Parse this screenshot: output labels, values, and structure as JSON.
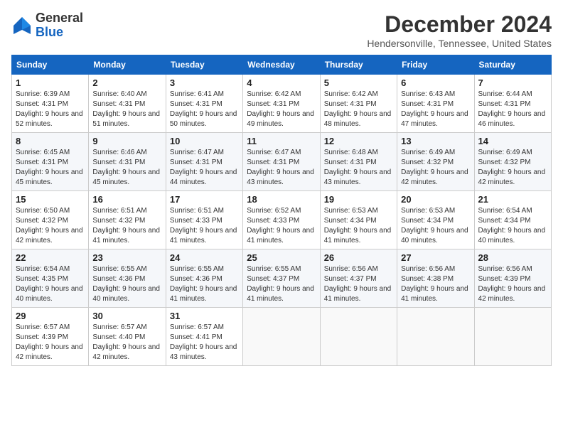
{
  "logo": {
    "line1": "General",
    "line2": "Blue"
  },
  "title": "December 2024",
  "location": "Hendersonville, Tennessee, United States",
  "days_of_week": [
    "Sunday",
    "Monday",
    "Tuesday",
    "Wednesday",
    "Thursday",
    "Friday",
    "Saturday"
  ],
  "weeks": [
    [
      {
        "day": "1",
        "sunrise": "6:39 AM",
        "sunset": "4:31 PM",
        "daylight": "9 hours and 52 minutes."
      },
      {
        "day": "2",
        "sunrise": "6:40 AM",
        "sunset": "4:31 PM",
        "daylight": "9 hours and 51 minutes."
      },
      {
        "day": "3",
        "sunrise": "6:41 AM",
        "sunset": "4:31 PM",
        "daylight": "9 hours and 50 minutes."
      },
      {
        "day": "4",
        "sunrise": "6:42 AM",
        "sunset": "4:31 PM",
        "daylight": "9 hours and 49 minutes."
      },
      {
        "day": "5",
        "sunrise": "6:42 AM",
        "sunset": "4:31 PM",
        "daylight": "9 hours and 48 minutes."
      },
      {
        "day": "6",
        "sunrise": "6:43 AM",
        "sunset": "4:31 PM",
        "daylight": "9 hours and 47 minutes."
      },
      {
        "day": "7",
        "sunrise": "6:44 AM",
        "sunset": "4:31 PM",
        "daylight": "9 hours and 46 minutes."
      }
    ],
    [
      {
        "day": "8",
        "sunrise": "6:45 AM",
        "sunset": "4:31 PM",
        "daylight": "9 hours and 45 minutes."
      },
      {
        "day": "9",
        "sunrise": "6:46 AM",
        "sunset": "4:31 PM",
        "daylight": "9 hours and 45 minutes."
      },
      {
        "day": "10",
        "sunrise": "6:47 AM",
        "sunset": "4:31 PM",
        "daylight": "9 hours and 44 minutes."
      },
      {
        "day": "11",
        "sunrise": "6:47 AM",
        "sunset": "4:31 PM",
        "daylight": "9 hours and 43 minutes."
      },
      {
        "day": "12",
        "sunrise": "6:48 AM",
        "sunset": "4:31 PM",
        "daylight": "9 hours and 43 minutes."
      },
      {
        "day": "13",
        "sunrise": "6:49 AM",
        "sunset": "4:32 PM",
        "daylight": "9 hours and 42 minutes."
      },
      {
        "day": "14",
        "sunrise": "6:49 AM",
        "sunset": "4:32 PM",
        "daylight": "9 hours and 42 minutes."
      }
    ],
    [
      {
        "day": "15",
        "sunrise": "6:50 AM",
        "sunset": "4:32 PM",
        "daylight": "9 hours and 42 minutes."
      },
      {
        "day": "16",
        "sunrise": "6:51 AM",
        "sunset": "4:32 PM",
        "daylight": "9 hours and 41 minutes."
      },
      {
        "day": "17",
        "sunrise": "6:51 AM",
        "sunset": "4:33 PM",
        "daylight": "9 hours and 41 minutes."
      },
      {
        "day": "18",
        "sunrise": "6:52 AM",
        "sunset": "4:33 PM",
        "daylight": "9 hours and 41 minutes."
      },
      {
        "day": "19",
        "sunrise": "6:53 AM",
        "sunset": "4:34 PM",
        "daylight": "9 hours and 41 minutes."
      },
      {
        "day": "20",
        "sunrise": "6:53 AM",
        "sunset": "4:34 PM",
        "daylight": "9 hours and 40 minutes."
      },
      {
        "day": "21",
        "sunrise": "6:54 AM",
        "sunset": "4:34 PM",
        "daylight": "9 hours and 40 minutes."
      }
    ],
    [
      {
        "day": "22",
        "sunrise": "6:54 AM",
        "sunset": "4:35 PM",
        "daylight": "9 hours and 40 minutes."
      },
      {
        "day": "23",
        "sunrise": "6:55 AM",
        "sunset": "4:36 PM",
        "daylight": "9 hours and 40 minutes."
      },
      {
        "day": "24",
        "sunrise": "6:55 AM",
        "sunset": "4:36 PM",
        "daylight": "9 hours and 41 minutes."
      },
      {
        "day": "25",
        "sunrise": "6:55 AM",
        "sunset": "4:37 PM",
        "daylight": "9 hours and 41 minutes."
      },
      {
        "day": "26",
        "sunrise": "6:56 AM",
        "sunset": "4:37 PM",
        "daylight": "9 hours and 41 minutes."
      },
      {
        "day": "27",
        "sunrise": "6:56 AM",
        "sunset": "4:38 PM",
        "daylight": "9 hours and 41 minutes."
      },
      {
        "day": "28",
        "sunrise": "6:56 AM",
        "sunset": "4:39 PM",
        "daylight": "9 hours and 42 minutes."
      }
    ],
    [
      {
        "day": "29",
        "sunrise": "6:57 AM",
        "sunset": "4:39 PM",
        "daylight": "9 hours and 42 minutes."
      },
      {
        "day": "30",
        "sunrise": "6:57 AM",
        "sunset": "4:40 PM",
        "daylight": "9 hours and 42 minutes."
      },
      {
        "day": "31",
        "sunrise": "6:57 AM",
        "sunset": "4:41 PM",
        "daylight": "9 hours and 43 minutes."
      },
      null,
      null,
      null,
      null
    ]
  ]
}
